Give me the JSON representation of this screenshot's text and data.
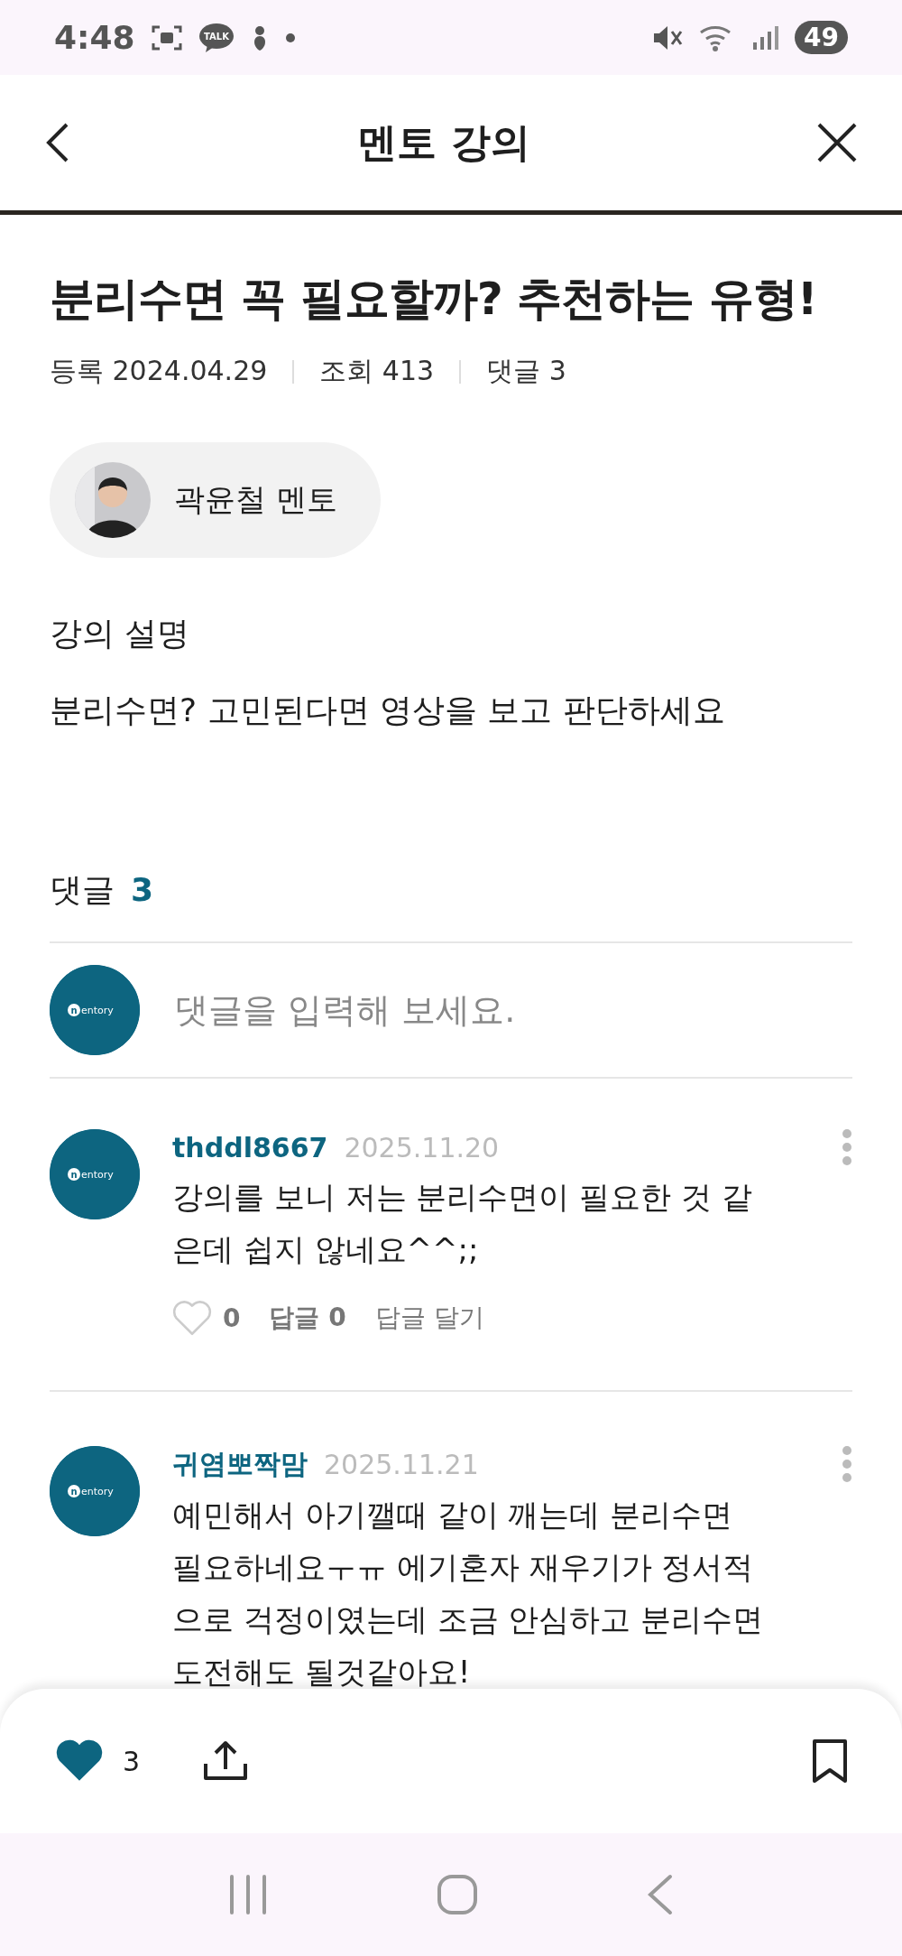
{
  "status_bar": {
    "time": "4:48",
    "talk_label": "TALK",
    "battery": "49"
  },
  "header": {
    "title": "멘토 강의"
  },
  "lecture": {
    "title": "분리수면 꼭 필요할까? 추천하는 유형!",
    "meta": [
      "등록 2024.04.29",
      "조회 413",
      "댓글 3"
    ],
    "mentor": {
      "name": "곽윤철 멘토"
    },
    "description_heading": "강의 설명",
    "description": "분리수면? 고민된다면 영상을 보고 판단하세요"
  },
  "comments_section": {
    "label": "댓글",
    "count": "3",
    "input": {
      "placeholder": "댓글을 입력해 보세요.",
      "logo_mark": "n",
      "logo_text": "entory"
    },
    "comments": [
      {
        "user": "thddl8667",
        "date": "2025.11.20",
        "text": "강의를 보니 저는 분리수면이 필요한 것 같은데 쉽지 않네요^^;;",
        "logo_mark": "n",
        "logo_text": "entory",
        "actions": {
          "liked": false,
          "likes": "0",
          "replies": "답글 0",
          "reply_button": "답글 달기"
        }
      },
      {
        "user": "귀염뽀짝맘",
        "date": "2025.11.21",
        "text": "예민해서 아기깰때 같이 깨는데 분리수면 필요하네요ㅜㅠ 에기혼자 재우기가 정서적으로 걱정이였는데 조금 안심하고 분리수면 도전해도 될것같아요!",
        "logo_mark": "n",
        "logo_text": "entory"
      }
    ]
  },
  "bottom_bar": {
    "liked": true,
    "likes": "3",
    "bookmarked": false
  }
}
